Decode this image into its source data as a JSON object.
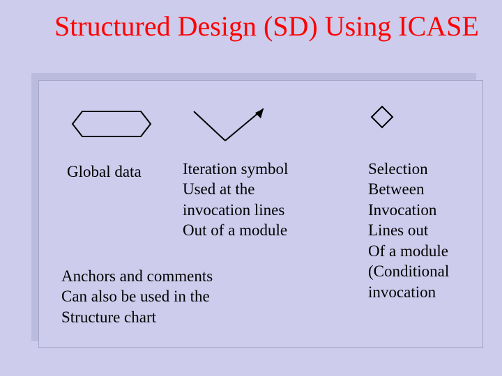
{
  "title": "Structured Design (SD) Using ICASE",
  "symbols": {
    "global": {
      "label": "Global data"
    },
    "iteration": {
      "label": "Iteration symbol\nUsed at the\ninvocation lines\nOut of a module"
    },
    "selection": {
      "label": "Selection\nBetween\nInvocation\nLines out\nOf a module\n(Conditional\ninvocation"
    }
  },
  "footnote": "Anchors and comments\nCan also be used in the\nStructure chart"
}
